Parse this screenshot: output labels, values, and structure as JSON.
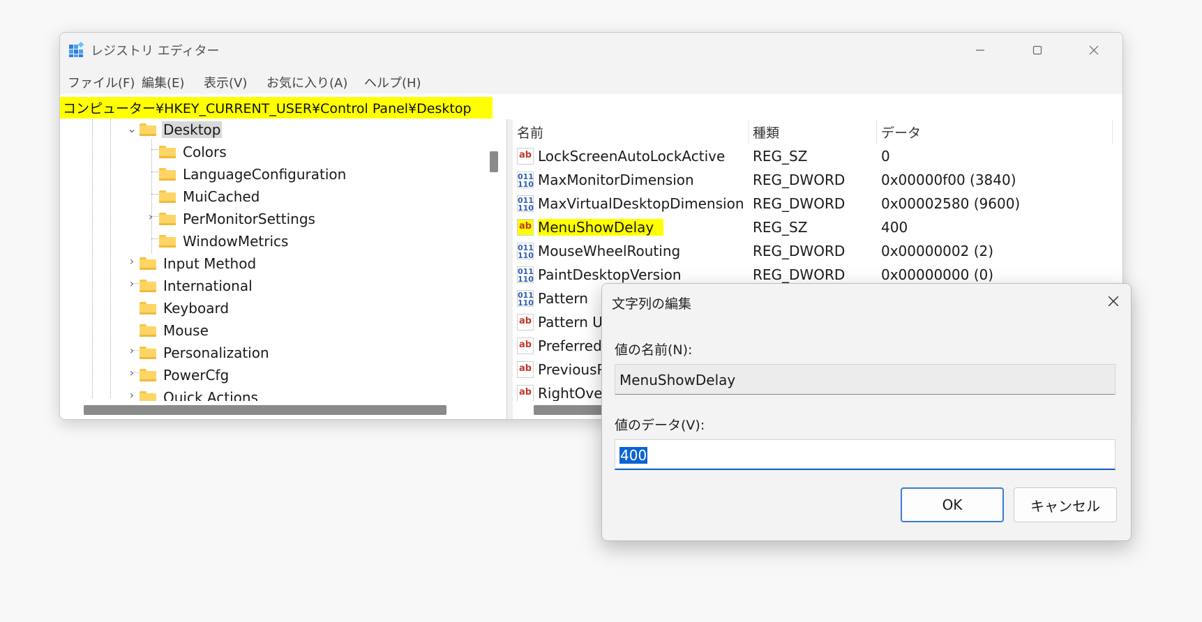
{
  "window": {
    "title": "レジストリ エディター",
    "minimize_icon": "minimize-icon",
    "maximize_icon": "maximize-icon",
    "close_icon": "close-icon"
  },
  "menu": [
    "ファイル(F)",
    "編集(E)",
    "表示(V)",
    "お気に入り(A)",
    "ヘルプ(H)"
  ],
  "address": "コンピューター¥HKEY_CURRENT_USER¥Control Panel¥Desktop",
  "tree": {
    "selected": "Desktop",
    "children": [
      "Colors",
      "LanguageConfiguration",
      "MuiCached",
      "PerMonitorSettings",
      "WindowMetrics"
    ],
    "siblings": [
      "Input Method",
      "International",
      "Keyboard",
      "Mouse",
      "Personalization",
      "PowerCfg",
      "Quick Actions"
    ]
  },
  "values": {
    "headers": [
      "名前",
      "種類",
      "データ"
    ],
    "rows": [
      {
        "name": "LockScreenAutoLockActive",
        "type": "REG_SZ",
        "data": "0",
        "icon": "string-value-icon"
      },
      {
        "name": "MaxMonitorDimension",
        "type": "REG_DWORD",
        "data": "0x00000f00 (3840)",
        "icon": "binary-value-icon"
      },
      {
        "name": "MaxVirtualDesktopDimension",
        "type": "REG_DWORD",
        "data": "0x00002580 (9600)",
        "icon": "binary-value-icon"
      },
      {
        "name": "MenuShowDelay",
        "type": "REG_SZ",
        "data": "400",
        "icon": "string-value-icon"
      },
      {
        "name": "MouseWheelRouting",
        "type": "REG_DWORD",
        "data": "0x00000002 (2)",
        "icon": "binary-value-icon"
      },
      {
        "name": "PaintDesktopVersion",
        "type": "REG_DWORD",
        "data": "0x00000000 (0)",
        "icon": "binary-value-icon"
      },
      {
        "name": "Pattern",
        "type": "",
        "data": "",
        "icon": "binary-value-icon"
      },
      {
        "name": "Pattern Up",
        "type": "",
        "data": "",
        "icon": "string-value-icon"
      },
      {
        "name": "PreferredU",
        "type": "",
        "data": "",
        "icon": "string-value-icon"
      },
      {
        "name": "PreviousPr",
        "type": "",
        "data": "",
        "icon": "string-value-icon"
      },
      {
        "name": "RightOverl",
        "type": "",
        "data": "",
        "icon": "string-value-icon"
      }
    ]
  },
  "dialog": {
    "title": "文字列の編集",
    "name_label": "値の名前(N):",
    "name_value": "MenuShowDelay",
    "data_label": "値のデータ(V):",
    "data_value": "400",
    "ok": "OK",
    "cancel": "キャンセル"
  },
  "colors": {
    "highlight": "#ffff00",
    "selection": "#0b64d3",
    "accent": "#3a7bd5"
  }
}
